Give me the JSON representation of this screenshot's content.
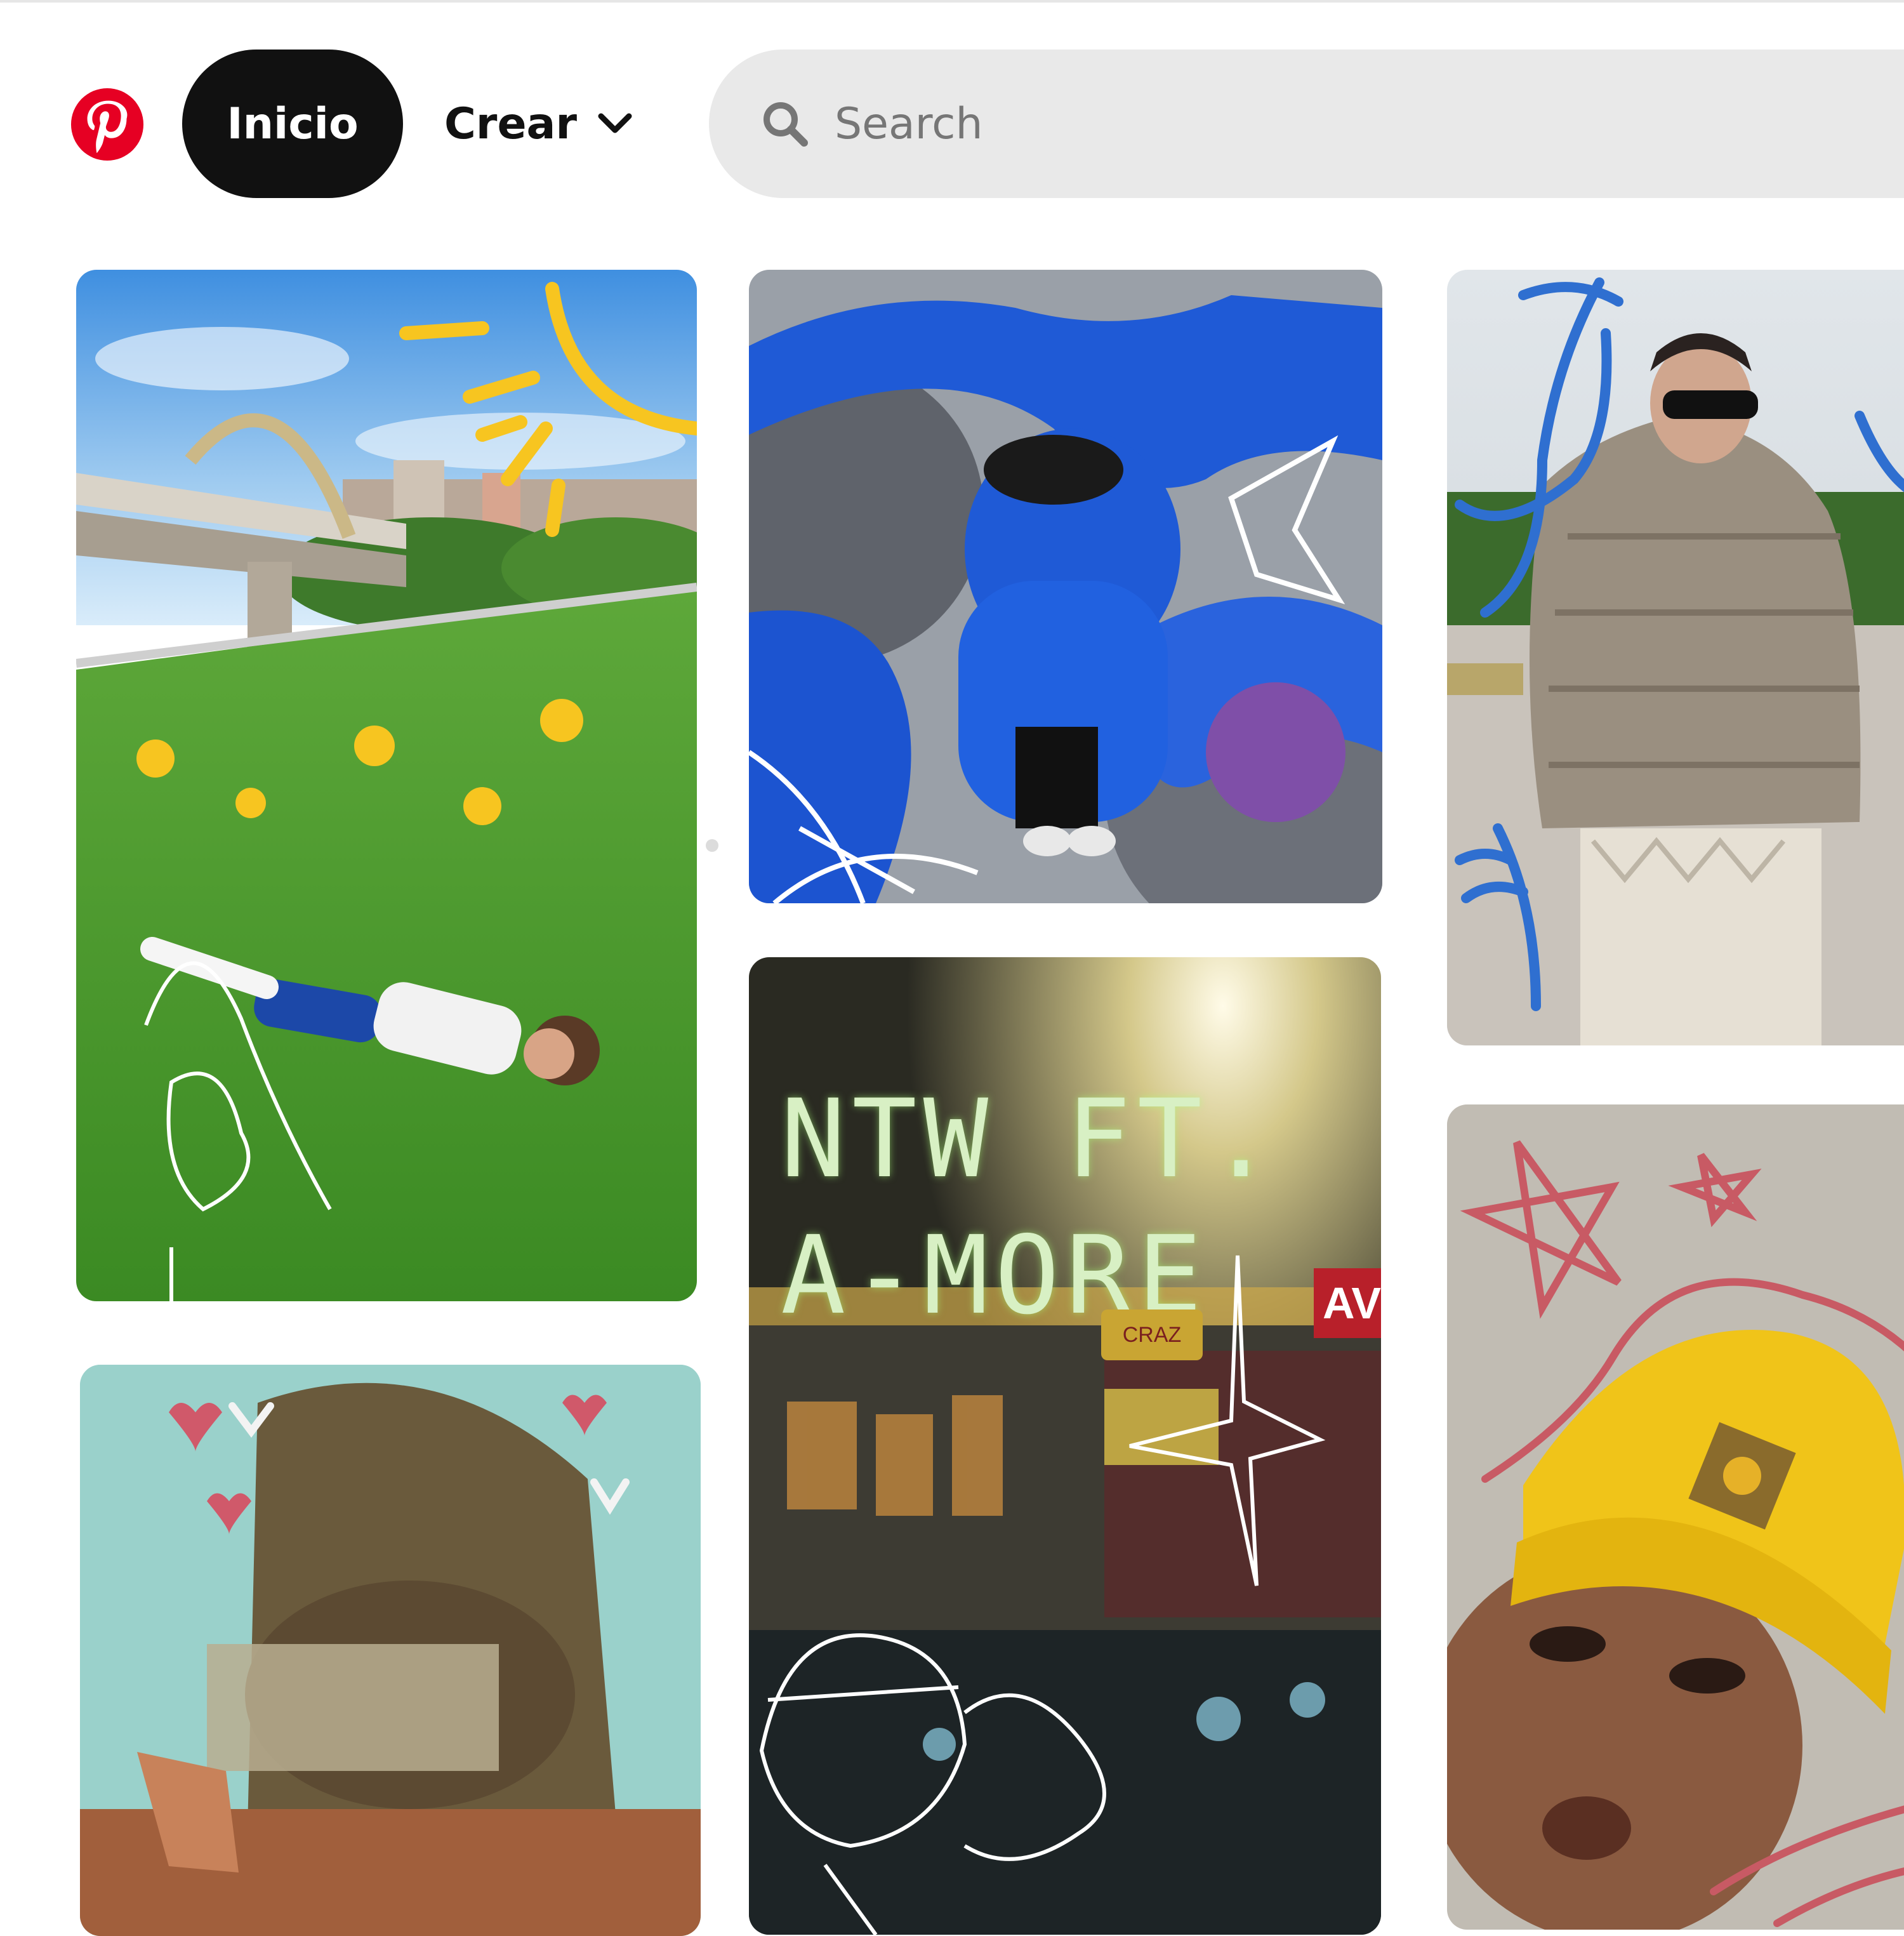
{
  "header": {
    "logo_icon": "pinterest-logo-icon",
    "nav": {
      "home_label": "Inicio",
      "create_label": "Crear",
      "create_icon": "chevron-down-icon"
    },
    "search": {
      "placeholder": "Search",
      "value": "",
      "icon": "search-icon"
    },
    "colors": {
      "brand": "#e60023",
      "active_nav_bg": "#111111",
      "search_bg": "#e9e9e9"
    }
  },
  "feed": {
    "pins": [
      {
        "id": "pin-1",
        "subject": "bridge-and-park-lying-on-grass"
      },
      {
        "id": "pin-2",
        "subject": "vintage-photo-with-hearts"
      },
      {
        "id": "pin-3",
        "subject": "blue-puffer-jacket-graffiti"
      },
      {
        "id": "pin-4",
        "subject": "night-street-neon",
        "title": "NTW FT.\nA-MORE",
        "sign_1": "AV",
        "sign_2": "CRAZ"
      },
      {
        "id": "pin-5",
        "subject": "plaid-puffer-jacket-sunglasses"
      },
      {
        "id": "pin-6",
        "subject": "yellow-beanie-selfie"
      }
    ]
  }
}
